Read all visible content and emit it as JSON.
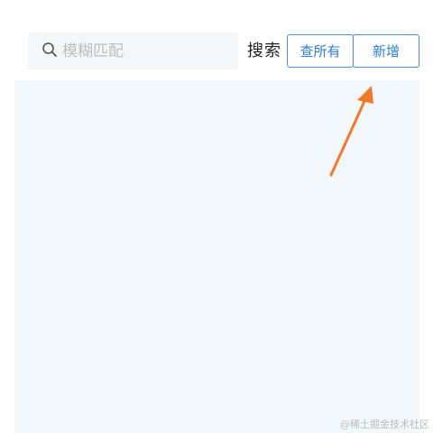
{
  "search": {
    "placeholder": "模糊匹配",
    "value": "",
    "icon": "search-icon",
    "label": "搜索"
  },
  "buttons": {
    "query_all": "查所有",
    "add_new": "新增"
  },
  "colors": {
    "accent": "#2f7fd0",
    "panel_bg": "#f1f7fa",
    "arrow": "#f07a2a"
  },
  "watermark": "@稀土掘金技术社区"
}
